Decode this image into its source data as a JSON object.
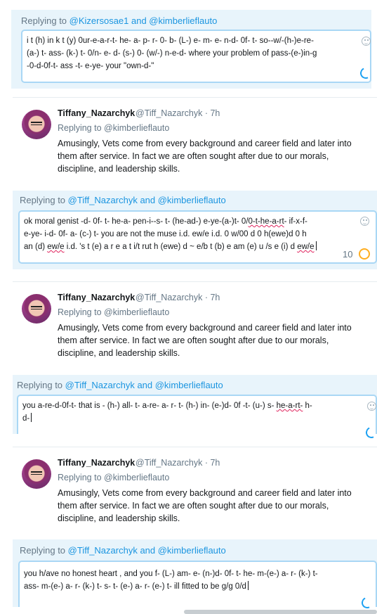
{
  "colors": {
    "accent": "#1b95e0",
    "panel": "#e8f4fb",
    "muted": "#657786",
    "spell_error": "#e0245e",
    "warning_ring": "#ffad1f"
  },
  "replies": [
    {
      "label_prefix": "Replying to ",
      "mentions": "@Kizersosae1 and @kimberlieflauto",
      "lines": [
        "i  t (h) in k t (y) 0ur-e-a-r-t- he- a- p- r- 0- b- (L-) e- m- e- n-d- 0f- t-  so--w/-(h-)e-re-",
        "(a-) t- ass- (k-) t- 0/n- e- d- (s-) 0- (w/-) n-e-d-  where your problem of pass-(e-)in-g",
        "-0-d-0f-t- ass -t- e-ye-  your \"own-d-\""
      ]
    },
    {
      "label_prefix": "Replying to ",
      "mentions": "@Tiff_Nazarchyk and @kimberlieflauto",
      "l1a": "ok moral genist -d- 0f- t- he-a- pen-i--s- t- (he-ad-) e-ye-(a-)t- 0/",
      "l1b": "0-t-he-a-rt",
      "l1c": "- if-x-f-",
      "line2": "e-ye- i-d- 0f- a- (c-) t-   you are not the muse i.d. ew/e i.d. 0 w/00 d 0 h(ewe)d 0 h",
      "l3a": "an (d) ",
      "l3b": "ew/e",
      "l3c": " i.d. 's t (e) a r e a t i/t rut h (ewe) d ~ e/b t (b) e am (e) u /s e (i) d ",
      "l3d": "ew/e",
      "char_count": "10"
    },
    {
      "label_prefix": "Replying to ",
      "mentions": "@Tiff_Nazarchyk and @kimberlieflauto",
      "l1a": "you a-re-d-0f-t-   that is - (h-) all- t- a-re- a- r- t- (h-) in- (e-)d- 0f -t- (u-) s- ",
      "l1b": "he-a-rt-",
      "l1c": " h-",
      "line2": "d-"
    },
    {
      "label_prefix": "Replying to ",
      "mentions": "@Tiff_Nazarchyk and @kimberlieflauto",
      "lines": [
        "you h/ave no honest heart , and you f- (L-) am- e- (n-)d- 0f- t- he- m-(e-) a- r- (k-) t-",
        "ass- m-(e-) a- r- (k-) t- s- t- (e-) a- r- (e-) t-  ill fitted to be g/g 0/d"
      ]
    }
  ],
  "tweet": {
    "display_name": "Tiffany_Nazarchyk",
    "handle": "@Tiff_Nazarchyk",
    "time": " · 7h",
    "replying_to": "Replying to @kimberlieflauto",
    "text": "Amusingly, Vets come from every background and career field and later into them after service. In fact we are often sought after due to our morals, discipline, and leadership skills."
  }
}
